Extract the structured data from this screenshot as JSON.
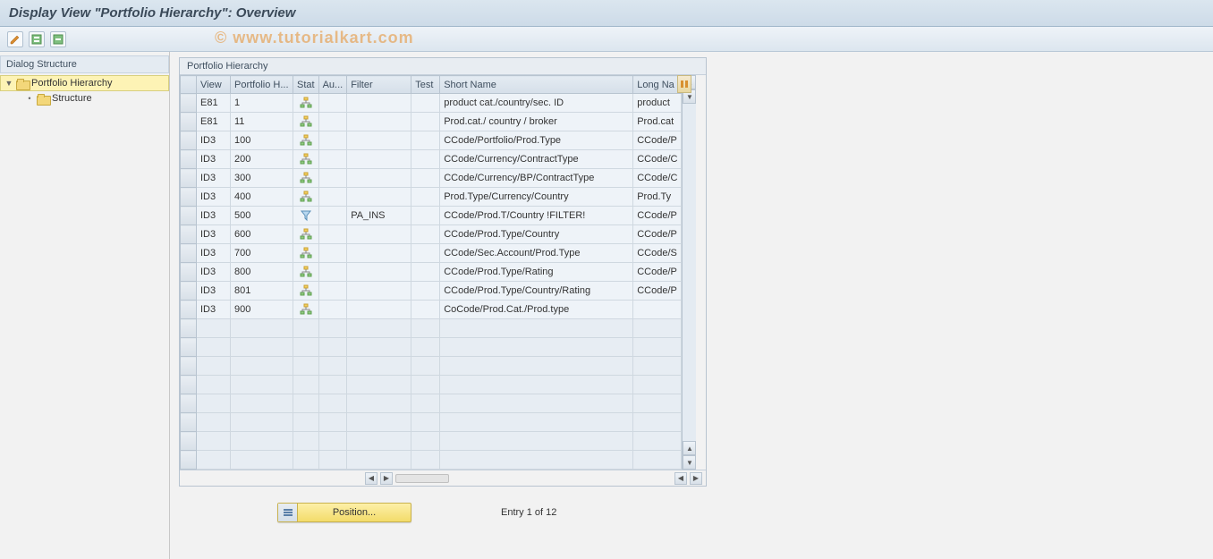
{
  "title": "Display View \"Portfolio Hierarchy\": Overview",
  "watermark": "© www.tutorialkart.com",
  "sidebar": {
    "header": "Dialog Structure",
    "items": [
      {
        "label": "Portfolio Hierarchy",
        "selected": true,
        "expanded": true
      },
      {
        "label": "Structure",
        "selected": false
      }
    ]
  },
  "grid": {
    "title": "Portfolio Hierarchy",
    "columns": [
      "View",
      "Portfolio H...",
      "Stat",
      "Au...",
      "Filter",
      "Test",
      "Short Name",
      "Long Na"
    ],
    "rows": [
      {
        "view": "E81",
        "ph": "1",
        "stat": "hier",
        "au": "",
        "filter": "",
        "test": "",
        "short": "product cat./country/sec. ID",
        "long": "product"
      },
      {
        "view": "E81",
        "ph": "11",
        "stat": "hier",
        "au": "",
        "filter": "",
        "test": "",
        "short": "Prod.cat./ country / broker",
        "long": "Prod.cat"
      },
      {
        "view": "ID3",
        "ph": "100",
        "stat": "hier",
        "au": "",
        "filter": "",
        "test": "",
        "short": "CCode/Portfolio/Prod.Type",
        "long": "CCode/P"
      },
      {
        "view": "ID3",
        "ph": "200",
        "stat": "hier",
        "au": "",
        "filter": "",
        "test": "",
        "short": "CCode/Currency/ContractType",
        "long": "CCode/C"
      },
      {
        "view": "ID3",
        "ph": "300",
        "stat": "hier",
        "au": "",
        "filter": "",
        "test": "",
        "short": "CCode/Currency/BP/ContractType",
        "long": "CCode/C"
      },
      {
        "view": "ID3",
        "ph": "400",
        "stat": "hier",
        "au": "",
        "filter": "",
        "test": "",
        "short": "Prod.Type/Currency/Country",
        "long": "Prod.Ty"
      },
      {
        "view": "ID3",
        "ph": "500",
        "stat": "filter",
        "au": "",
        "filter": "PA_INS",
        "test": "",
        "short": "CCode/Prod.T/Country !FILTER!",
        "long": "CCode/P"
      },
      {
        "view": "ID3",
        "ph": "600",
        "stat": "hier",
        "au": "",
        "filter": "",
        "test": "",
        "short": "CCode/Prod.Type/Country",
        "long": "CCode/P"
      },
      {
        "view": "ID3",
        "ph": "700",
        "stat": "hier",
        "au": "",
        "filter": "",
        "test": "",
        "short": "CCode/Sec.Account/Prod.Type",
        "long": "CCode/S"
      },
      {
        "view": "ID3",
        "ph": "800",
        "stat": "hier",
        "au": "",
        "filter": "",
        "test": "",
        "short": "CCode/Prod.Type/Rating",
        "long": "CCode/P"
      },
      {
        "view": "ID3",
        "ph": "801",
        "stat": "hier",
        "au": "",
        "filter": "",
        "test": "",
        "short": "CCode/Prod.Type/Country/Rating",
        "long": "CCode/P"
      },
      {
        "view": "ID3",
        "ph": "900",
        "stat": "hier",
        "au": "",
        "filter": "",
        "test": "",
        "short": "CoCode/Prod.Cat./Prod.type",
        "long": ""
      }
    ],
    "empty_rows": 8
  },
  "footer": {
    "position_label": "Position...",
    "entry_label": "Entry 1 of 12"
  }
}
